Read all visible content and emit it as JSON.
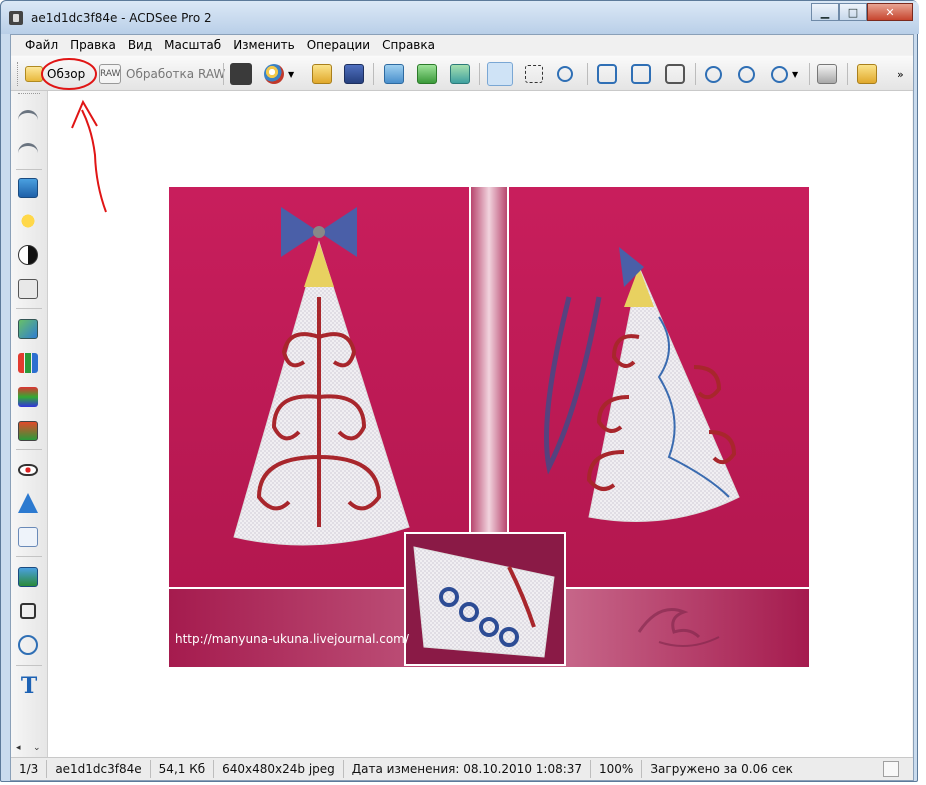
{
  "window": {
    "title": "ae1d1dc3f84e - ACDSee Pro 2",
    "minimize": "▁",
    "maximize": "□",
    "close": "✕"
  },
  "menu": [
    "Файл",
    "Правка",
    "Вид",
    "Масштаб",
    "Изменить",
    "Операции",
    "Справка"
  ],
  "toolbar": {
    "browse_label": "Обзор",
    "raw_label": "Обработка RAW",
    "raw_badge": "RAW",
    "overflow": "»"
  },
  "image": {
    "watermark_url": "http://manyuna-ukuna.livejournal.com/",
    "signature_text": "Manyuna"
  },
  "status": {
    "position": "1/3",
    "filename": "ae1d1dc3f84e",
    "filesize": "54,1 Кб",
    "dimensions": "640x480x24b jpeg",
    "modified": "Дата изменения: 08.10.2010 1:08:37",
    "zoom": "100%",
    "loaded": "Загружено за 0.06 сек"
  },
  "colors": {
    "background_magenta": "#c8195a",
    "annotation_red": "#e01515"
  }
}
